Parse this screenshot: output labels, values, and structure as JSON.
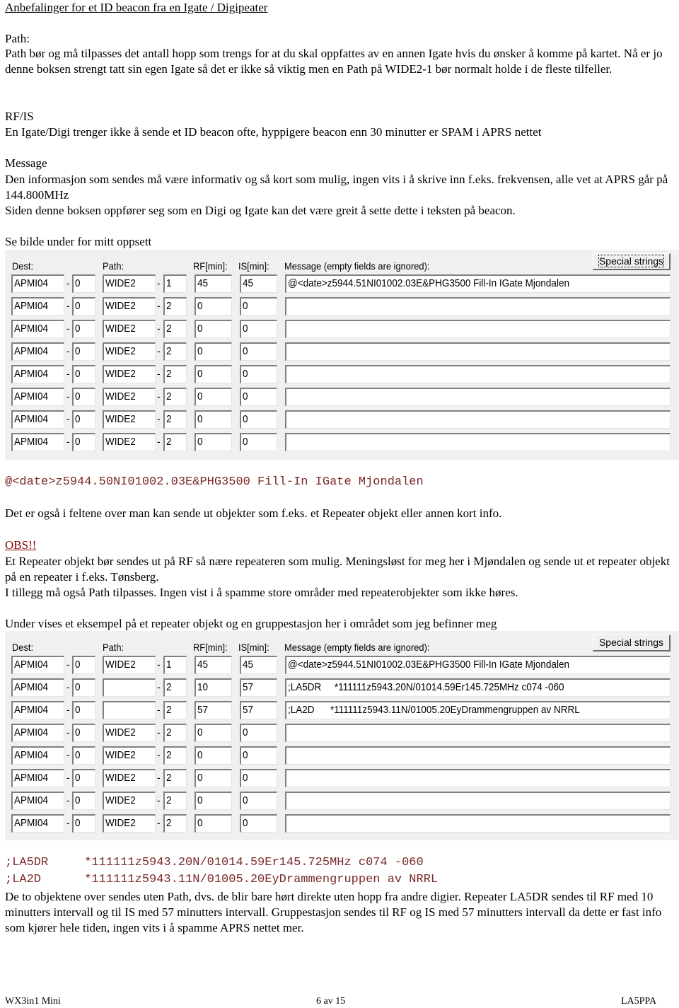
{
  "title": "Anbefalinger for et ID beacon fra en Igate / Digipeater",
  "sections": {
    "path_heading": "Path:",
    "path_text": "Path bør og må tilpasses det antall hopp som trengs for at du skal oppfattes av en annen Igate hvis du ønsker å komme på kartet. Nå er jo denne boksen strengt tatt sin egen Igate så det er ikke så viktig men en Path på WIDE2-1 bør normalt holde i de fleste tilfeller.",
    "rfis_heading": "RF/IS",
    "rfis_text": "En Igate/Digi trenger ikke å sende et ID beacon ofte, hyppigere beacon enn 30 minutter er SPAM i APRS nettet",
    "message_heading": "Message",
    "message_text": "Den informasjon som sendes må være informativ og så kort som mulig, ingen vits i å skrive inn f.eks. frekvensen, alle vet at APRS går på 144.800MHz",
    "message_text2": "Siden denne boksen oppfører seg som en Digi og Igate kan det være greit å sette dette i teksten på beacon.",
    "see_image": "Se bilde under for mitt oppsett",
    "beacon_code": "@<date>z5944.50NI01002.03E&PHG3500 Fill-In IGate Mjondalen",
    "objects_text": "Det er også i feltene over man kan sende ut objekter som f.eks. et Repeater objekt eller annen kort info.",
    "obs_heading": "OBS!!",
    "obs_text": "Et Repeater objekt bør sendes ut på RF så nære repeateren som mulig. Meningsløst for meg her i Mjøndalen og sende ut et repeater objekt på en repeater i f.eks. Tønsberg.",
    "obs_text2": "I tillegg må også Path tilpasses. Ingen vist i å spamme store områder med repeaterobjekter som ikke høres.",
    "example_intro": "Under vises et eksempel på et repeater objekt og en gruppestasjon her i området som jeg befinner meg",
    "code_line1": ";LA5DR     *111111z5943.20N/01014.59Er145.725MHz c074 -060",
    "code_line2": ";LA2D      *111111z5943.11N/01005.20EyDrammengruppen av NRRL",
    "closing_text": "De to objektene over sendes uten Path, dvs. de blir bare hørt direkte uten hopp fra andre digier. Repeater LA5DR sendes til RF med 10 minutters intervall og til IS med 57 minutters intervall. Gruppestasjon sendes til RF og IS med 57 minutters intervall da dette er fast info som kjører hele tiden, ingen vits i å spamme APRS nettet mer."
  },
  "panel_labels": {
    "dest": "Dest:",
    "path": "Path:",
    "rf": "RF[min]:",
    "is": "IS[min]:",
    "message": "Message (empty fields are ignored):",
    "special_strings": "Special strings",
    "dash": "-"
  },
  "panel1": {
    "rows": [
      {
        "dest": "APMI04",
        "ssid": "0",
        "path": "WIDE2",
        "hops": "1",
        "rf": "45",
        "is": "45",
        "msg": "@<date>z5944.51NI01002.03E&PHG3500 Fill-In IGate Mjondalen"
      },
      {
        "dest": "APMI04",
        "ssid": "0",
        "path": "WIDE2",
        "hops": "2",
        "rf": "0",
        "is": "0",
        "msg": ""
      },
      {
        "dest": "APMI04",
        "ssid": "0",
        "path": "WIDE2",
        "hops": "2",
        "rf": "0",
        "is": "0",
        "msg": ""
      },
      {
        "dest": "APMI04",
        "ssid": "0",
        "path": "WIDE2",
        "hops": "2",
        "rf": "0",
        "is": "0",
        "msg": ""
      },
      {
        "dest": "APMI04",
        "ssid": "0",
        "path": "WIDE2",
        "hops": "2",
        "rf": "0",
        "is": "0",
        "msg": ""
      },
      {
        "dest": "APMI04",
        "ssid": "0",
        "path": "WIDE2",
        "hops": "2",
        "rf": "0",
        "is": "0",
        "msg": ""
      },
      {
        "dest": "APMI04",
        "ssid": "0",
        "path": "WIDE2",
        "hops": "2",
        "rf": "0",
        "is": "0",
        "msg": ""
      },
      {
        "dest": "APMI04",
        "ssid": "0",
        "path": "WIDE2",
        "hops": "2",
        "rf": "0",
        "is": "0",
        "msg": ""
      }
    ]
  },
  "panel2": {
    "rows": [
      {
        "dest": "APMI04",
        "ssid": "0",
        "path": "WIDE2",
        "hops": "1",
        "rf": "45",
        "is": "45",
        "msg": "@<date>z5944.51NI01002.03E&PHG3500 Fill-In IGate Mjondalen"
      },
      {
        "dest": "APMI04",
        "ssid": "0",
        "path": "",
        "hops": "2",
        "rf": "10",
        "is": "57",
        "msg": ";LA5DR     *111111z5943.20N/01014.59Er145.725MHz c074 -060"
      },
      {
        "dest": "APMI04",
        "ssid": "0",
        "path": "",
        "hops": "2",
        "rf": "57",
        "is": "57",
        "msg": ";LA2D      *111111z5943.11N/01005.20EyDrammengruppen av NRRL"
      },
      {
        "dest": "APMI04",
        "ssid": "0",
        "path": "WIDE2",
        "hops": "2",
        "rf": "0",
        "is": "0",
        "msg": ""
      },
      {
        "dest": "APMI04",
        "ssid": "0",
        "path": "WIDE2",
        "hops": "2",
        "rf": "0",
        "is": "0",
        "msg": ""
      },
      {
        "dest": "APMI04",
        "ssid": "0",
        "path": "WIDE2",
        "hops": "2",
        "rf": "0",
        "is": "0",
        "msg": ""
      },
      {
        "dest": "APMI04",
        "ssid": "0",
        "path": "WIDE2",
        "hops": "2",
        "rf": "0",
        "is": "0",
        "msg": ""
      },
      {
        "dest": "APMI04",
        "ssid": "0",
        "path": "WIDE2",
        "hops": "2",
        "rf": "0",
        "is": "0",
        "msg": ""
      }
    ]
  },
  "footer": {
    "left": "WX3in1 Mini",
    "center": "6 av 15",
    "right": "LA5PPA"
  }
}
